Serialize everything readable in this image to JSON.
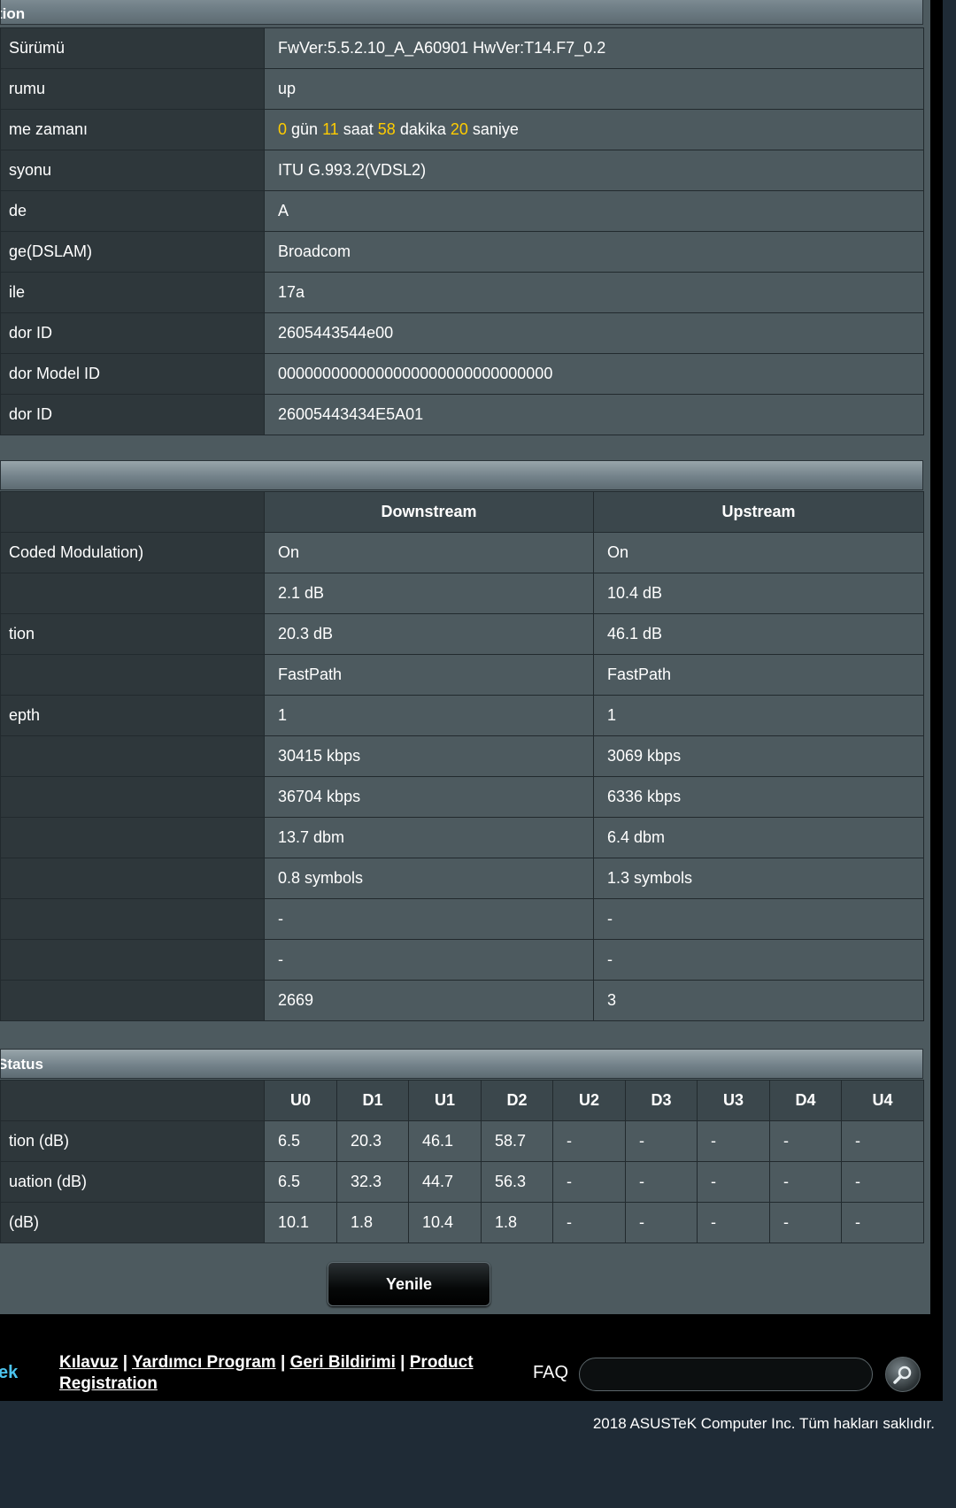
{
  "sections": {
    "info_title": "tion",
    "line_title": "",
    "status_title": "Status"
  },
  "info_rows": [
    {
      "label": "Sürümü",
      "value": "FwVer:5.5.2.10_A_A60901 HwVer:T14.F7_0.2"
    },
    {
      "label": "rumu",
      "value": "up"
    },
    {
      "label": "me zamanı",
      "uptime": {
        "days": "0",
        "days_unit": " gün ",
        "hours": "11",
        "hours_unit": " saat ",
        "minutes": "58",
        "minutes_unit": " dakika ",
        "seconds": "20",
        "seconds_unit": " saniye"
      }
    },
    {
      "label": "syonu",
      "value": "ITU G.993.2(VDSL2)"
    },
    {
      "label": "de",
      "value": "A"
    },
    {
      "label": "ge(DSLAM)",
      "value": "Broadcom"
    },
    {
      "label": "ile",
      "value": "17a"
    },
    {
      "label": "dor ID",
      "value": "2605443544e00"
    },
    {
      "label": "dor Model ID",
      "value": "0000000000000000000000000000000"
    },
    {
      "label": "dor ID",
      "value": "26005443434E5A01"
    }
  ],
  "line_headers": {
    "downstream": "Downstream",
    "upstream": "Upstream"
  },
  "line_rows": [
    {
      "label": "Coded Modulation)",
      "down": "On",
      "up": "On"
    },
    {
      "label": "",
      "down": "2.1 dB",
      "up": "10.4 dB"
    },
    {
      "label": "tion",
      "down": "20.3 dB",
      "up": "46.1 dB"
    },
    {
      "label": "",
      "down": "FastPath",
      "up": "FastPath"
    },
    {
      "label": "epth",
      "down": "1",
      "up": "1"
    },
    {
      "label": "",
      "down": "30415 kbps",
      "up": "3069 kbps"
    },
    {
      "label": "",
      "down": "36704 kbps",
      "up": "6336 kbps"
    },
    {
      "label": "",
      "down": "13.7 dbm",
      "up": "6.4 dbm"
    },
    {
      "label": "",
      "down": "0.8 symbols",
      "up": "1.3 symbols"
    },
    {
      "label": "",
      "down": "-",
      "up": "-"
    },
    {
      "label": "",
      "down": "-",
      "up": "-"
    },
    {
      "label": "",
      "down": "2669",
      "up": "3"
    }
  ],
  "band_headers": [
    "U0",
    "D1",
    "U1",
    "D2",
    "U2",
    "D3",
    "U3",
    "D4",
    "U4"
  ],
  "band_rows": [
    {
      "label": "tion (dB)",
      "values": [
        "6.5",
        "20.3",
        "46.1",
        "58.7",
        "-",
        "-",
        "-",
        "-",
        "-"
      ]
    },
    {
      "label": "uation (dB)",
      "values": [
        "6.5",
        "32.3",
        "44.7",
        "56.3",
        "-",
        "-",
        "-",
        "-",
        "-"
      ]
    },
    {
      "label": "(dB)",
      "values": [
        "10.1",
        "1.8",
        "10.4",
        "1.8",
        "-",
        "-",
        "-",
        "-",
        "-"
      ]
    }
  ],
  "colors": {
    "upstream_band": "#4cc4ee",
    "downstream_band": "#f5a130",
    "uptime_number": "#ffcc00"
  },
  "refresh_button": "Yenile",
  "footer": {
    "brand": "ek",
    "links": [
      "Kılavuz",
      "Yardımcı Program",
      "Geri Bildirimi",
      "Product Registration"
    ],
    "separator": " | ",
    "faq_label": "FAQ",
    "faq_placeholder": "",
    "copyright": "2018 ASUSTeK Computer Inc. Tüm hakları saklıdır."
  },
  "icons": {
    "search": "search-icon"
  }
}
